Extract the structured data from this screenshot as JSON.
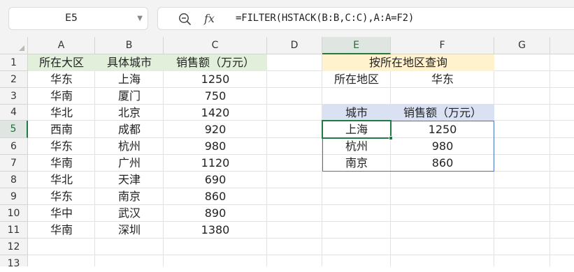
{
  "formula_bar": {
    "name_box": "E5",
    "zoom_icon": "magnifier-icon",
    "fx_label": "fx",
    "formula": "=FILTER(HSTACK(B:B,C:C),A:A=F2)"
  },
  "columns": [
    "A",
    "B",
    "C",
    "D",
    "E",
    "F",
    "G"
  ],
  "rows": [
    "1",
    "2",
    "3",
    "4",
    "5",
    "6",
    "7",
    "8",
    "9",
    "10",
    "11",
    "12",
    "13"
  ],
  "source_table": {
    "headers": [
      "所在大区",
      "具体城市",
      "销售额（万元）"
    ],
    "rows": [
      [
        "华东",
        "上海",
        "1250"
      ],
      [
        "华南",
        "厦门",
        "750"
      ],
      [
        "华北",
        "北京",
        "1420"
      ],
      [
        "西南",
        "成都",
        "920"
      ],
      [
        "华东",
        "杭州",
        "980"
      ],
      [
        "华南",
        "广州",
        "1120"
      ],
      [
        "华北",
        "天津",
        "690"
      ],
      [
        "华东",
        "南京",
        "860"
      ],
      [
        "华中",
        "武汉",
        "890"
      ],
      [
        "华南",
        "深圳",
        "1380"
      ]
    ]
  },
  "query": {
    "title": "按所在地区查询",
    "label": "所在地区",
    "value": "华东"
  },
  "result_table": {
    "headers": [
      "城市",
      "销售额（万元）"
    ],
    "rows": [
      [
        "上海",
        "1250"
      ],
      [
        "杭州",
        "980"
      ],
      [
        "南京",
        "860"
      ]
    ]
  },
  "colors": {
    "header_green": "#e2efda",
    "header_yellow": "#fff2cc",
    "header_blue": "#d9e1f2",
    "selection_green": "#1f7a43",
    "result_border": "#4472c4"
  }
}
